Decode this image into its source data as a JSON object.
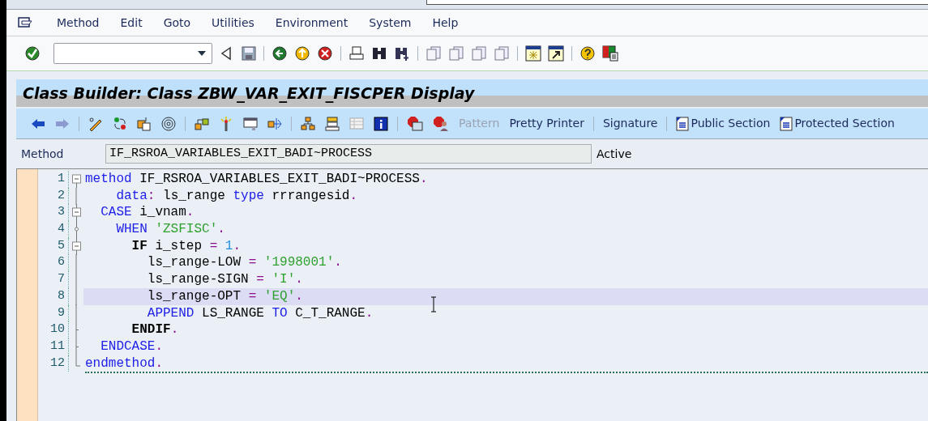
{
  "menu_bar": {
    "items": [
      {
        "label": "Method"
      },
      {
        "label": "Edit"
      },
      {
        "label": "Goto"
      },
      {
        "label": "Utilities"
      },
      {
        "label": "Environment"
      },
      {
        "label": "System"
      },
      {
        "label": "Help"
      }
    ]
  },
  "title_bar": {
    "title": "Class Builder: Class ZBW_VAR_EXIT_FISCPER Display"
  },
  "app_toolbar": {
    "buttons": [
      {
        "label": "Pattern",
        "disabled": true,
        "kind": "text"
      },
      {
        "label": "Pretty Printer",
        "disabled": false,
        "kind": "text"
      },
      {
        "label": "Signature",
        "disabled": false,
        "kind": "text"
      },
      {
        "label": "Public Section",
        "disabled": false,
        "kind": "doc"
      },
      {
        "label": "Protected Section",
        "disabled": false,
        "kind": "doc"
      }
    ]
  },
  "method_field": {
    "label": "Method",
    "value": "IF_RSROA_VARIABLES_EXIT_BADI~PROCESS",
    "status": "Active"
  },
  "editor": {
    "lines": [
      {
        "number": "1",
        "kind": "fold_start",
        "selected": false,
        "tokens": [
          {
            "kind": "keyword",
            "text": "method"
          },
          {
            "kind": "ident",
            "text": " IF_RSROA_VARIABLES_EXIT_BADI~PROCESS"
          },
          {
            "kind": "punct",
            "text": "."
          }
        ]
      },
      {
        "number": "2",
        "kind": "fold_inner",
        "selected": false,
        "tokens": [
          {
            "kind": "keyword",
            "text": "    data"
          },
          {
            "kind": "punct",
            "text": ":"
          },
          {
            "kind": "ident",
            "text": " ls_range "
          },
          {
            "kind": "keyword",
            "text": "type"
          },
          {
            "kind": "ident",
            "text": " rrrangesid"
          },
          {
            "kind": "punct",
            "text": "."
          }
        ]
      },
      {
        "number": "3",
        "kind": "fold_start",
        "selected": false,
        "tokens": [
          {
            "kind": "keyword",
            "text": "  CASE"
          },
          {
            "kind": "ident",
            "text": " i_vnam"
          },
          {
            "kind": "punct",
            "text": "."
          }
        ]
      },
      {
        "number": "4",
        "kind": "fold_branch",
        "selected": false,
        "tokens": [
          {
            "kind": "keyword",
            "text": "    WHEN"
          },
          {
            "kind": "string",
            "text": " 'ZSFISC'"
          },
          {
            "kind": "punct",
            "text": "."
          }
        ]
      },
      {
        "number": "5",
        "kind": "fold_start",
        "selected": false,
        "tokens": [
          {
            "kind": "bold",
            "text": "      IF"
          },
          {
            "kind": "ident",
            "text": " i_step"
          },
          {
            "kind": "punct",
            "text": " ="
          },
          {
            "kind": "number",
            "text": " 1"
          },
          {
            "kind": "punct",
            "text": "."
          }
        ]
      },
      {
        "number": "6",
        "kind": "fold_inner",
        "selected": false,
        "tokens": [
          {
            "kind": "ident",
            "text": "        ls_range-LOW"
          },
          {
            "kind": "punct",
            "text": " ="
          },
          {
            "kind": "string",
            "text": " '1998001'"
          },
          {
            "kind": "punct",
            "text": "."
          }
        ]
      },
      {
        "number": "7",
        "kind": "fold_inner",
        "selected": false,
        "tokens": [
          {
            "kind": "ident",
            "text": "        ls_range-SIGN"
          },
          {
            "kind": "punct",
            "text": " ="
          },
          {
            "kind": "string",
            "text": " 'I'"
          },
          {
            "kind": "punct",
            "text": "."
          }
        ]
      },
      {
        "number": "8",
        "kind": "fold_inner",
        "selected": true,
        "tokens": [
          {
            "kind": "ident",
            "text": "        ls_range-OPT"
          },
          {
            "kind": "punct",
            "text": " ="
          },
          {
            "kind": "string",
            "text": " 'EQ'"
          },
          {
            "kind": "punct",
            "text": "."
          }
        ]
      },
      {
        "number": "9",
        "kind": "fold_inner",
        "selected": false,
        "tokens": [
          {
            "kind": "keyword",
            "text": "        APPEND"
          },
          {
            "kind": "ident",
            "text": " LS_RANGE "
          },
          {
            "kind": "keyword",
            "text": "TO"
          },
          {
            "kind": "ident",
            "text": " C_T_RANGE"
          },
          {
            "kind": "punct",
            "text": "."
          }
        ]
      },
      {
        "number": "10",
        "kind": "fold_end",
        "selected": false,
        "tokens": [
          {
            "kind": "bold",
            "text": "      ENDIF"
          },
          {
            "kind": "punct",
            "text": "."
          }
        ]
      },
      {
        "number": "11",
        "kind": "fold_end",
        "selected": false,
        "tokens": [
          {
            "kind": "keyword",
            "text": "  ENDCASE"
          },
          {
            "kind": "punct",
            "text": "."
          }
        ]
      },
      {
        "number": "12",
        "kind": "fold_last",
        "selected": false,
        "tokens": [
          {
            "kind": "keyword",
            "text": "endmethod"
          },
          {
            "kind": "punct",
            "text": "."
          }
        ]
      }
    ]
  }
}
